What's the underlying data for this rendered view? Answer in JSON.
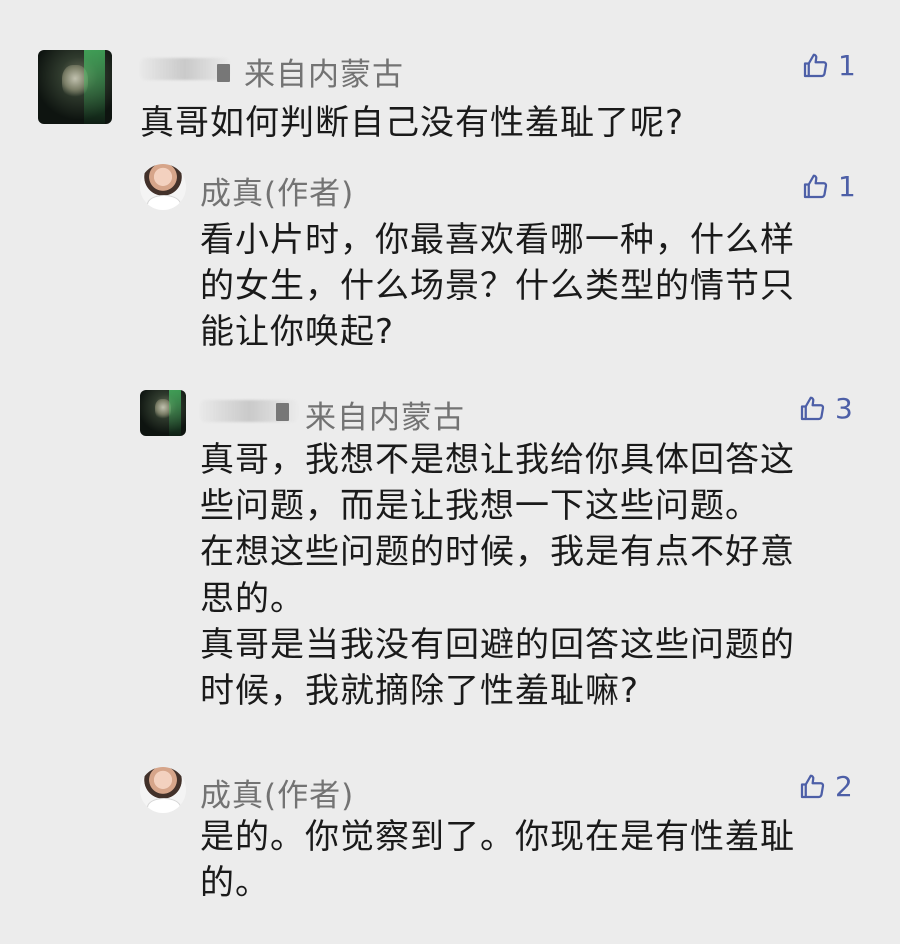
{
  "comments": [
    {
      "location": "来自内蒙古",
      "likes": "1",
      "text": "真哥如何判断自己没有性羞耻了呢?",
      "avatar": "dark-portrait-avatar"
    },
    {
      "author": "成真(作者)",
      "likes": "1",
      "text": "看小片时，你最喜欢看哪一种，什么样\n的女生，什么场景？什么类型的情节只\n能让你唤起?",
      "avatar": "author-avatar"
    },
    {
      "location": "来自内蒙古",
      "likes": "3",
      "text": "真哥，我想不是想让我给你具体回答这\n些问题，而是让我想一下这些问题。\n在想这些问题的时候，我是有点不好意\n思的。\n真哥是当我没有回避的回答这些问题的\n时候，我就摘除了性羞耻嘛?",
      "avatar": "dark-portrait-avatar"
    },
    {
      "author": "成真(作者)",
      "likes": "2",
      "text": "是的。你觉察到了。你现在是有性羞耻\n的。",
      "avatar": "author-avatar"
    }
  ],
  "icons": {
    "like": "thumbs-up-icon"
  },
  "colors": {
    "background": "#ececec",
    "meta_text": "#737373",
    "body_text": "#1a1a1a",
    "like_blue": "#4d5fa7"
  }
}
